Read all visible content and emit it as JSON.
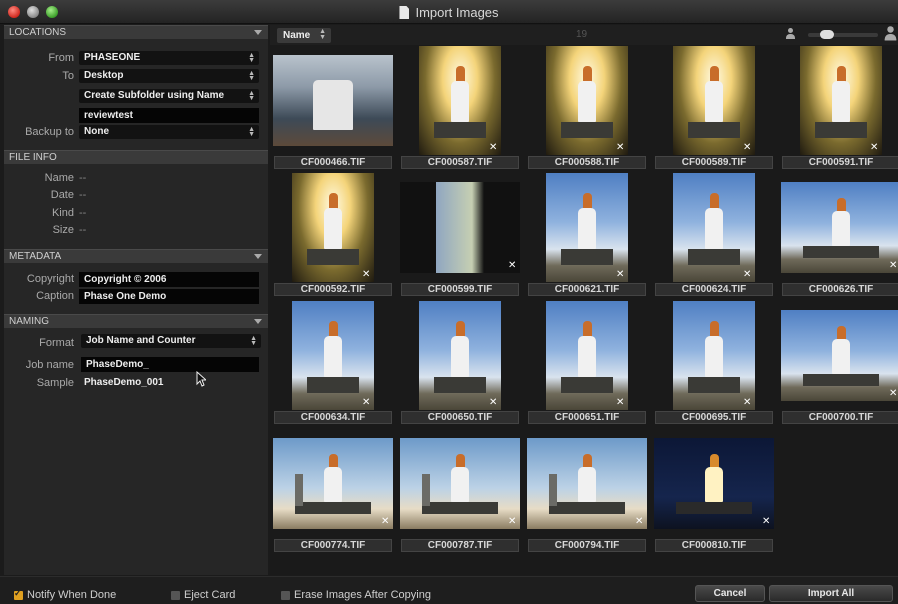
{
  "window": {
    "title": "Import Images"
  },
  "locations": {
    "header": "LOCATIONS",
    "from_label": "From",
    "from_value": "PHASEONE",
    "to_label": "To",
    "to_value": "Desktop",
    "subfolder_value": "Create Subfolder using Name",
    "subfolder_name": "reviewtest",
    "backup_label": "Backup to",
    "backup_value": "None"
  },
  "file_info": {
    "header": "FILE INFO",
    "rows": [
      {
        "label": "Name",
        "value": "--"
      },
      {
        "label": "Date",
        "value": "--"
      },
      {
        "label": "Kind",
        "value": "--"
      },
      {
        "label": "Size",
        "value": "--"
      }
    ]
  },
  "metadata": {
    "header": "METADATA",
    "copyright_label": "Copyright",
    "copyright_value": "Copyright © 2006",
    "caption_label": "Caption",
    "caption_value": "Phase One Demo"
  },
  "naming": {
    "header": "NAMING",
    "format_label": "Format",
    "format_value": "Job Name and Counter",
    "jobname_label": "Job name",
    "jobname_value": "PhaseDemo_",
    "sample_label": "Sample",
    "sample_value": "PhaseDemo_001"
  },
  "toolbar": {
    "sort_value": "Name",
    "count": "19"
  },
  "images": [
    {
      "name": "CF000466.TIF",
      "kind": "interior"
    },
    {
      "name": "CF000587.TIF",
      "kind": "night"
    },
    {
      "name": "CF000588.TIF",
      "kind": "night"
    },
    {
      "name": "CF000589.TIF",
      "kind": "night"
    },
    {
      "name": "CF000591.TIF",
      "kind": "night"
    },
    {
      "name": "CF000592.TIF",
      "kind": "night"
    },
    {
      "name": "CF000599.TIF",
      "kind": "door"
    },
    {
      "name": "CF000621.TIF",
      "kind": "sky"
    },
    {
      "name": "CF000624.TIF",
      "kind": "sky"
    },
    {
      "name": "CF000626.TIF",
      "kind": "sky"
    },
    {
      "name": "CF000634.TIF",
      "kind": "sky"
    },
    {
      "name": "CF000650.TIF",
      "kind": "sky"
    },
    {
      "name": "CF000651.TIF",
      "kind": "sky"
    },
    {
      "name": "CF000695.TIF",
      "kind": "sky"
    },
    {
      "name": "CF000700.TIF",
      "kind": "sky"
    },
    {
      "name": "CF000774.TIF",
      "kind": "dusk"
    },
    {
      "name": "CF000787.TIF",
      "kind": "dusk"
    },
    {
      "name": "CF000794.TIF",
      "kind": "dusk"
    },
    {
      "name": "CF000810.TIF",
      "kind": "nightpad"
    }
  ],
  "footer": {
    "notify_label": "Notify When Done",
    "notify_checked": true,
    "eject_label": "Eject Card",
    "eject_checked": false,
    "erase_label": "Erase Images After Copying",
    "erase_checked": false,
    "cancel_label": "Cancel",
    "import_label": "Import All"
  },
  "icons": {
    "close": "close-icon",
    "minimize": "minimize-icon",
    "zoom": "zoom-icon",
    "document": "document-icon",
    "remove": "remove-icon",
    "user": "user-icon",
    "pointer": "mouse-pointer-icon"
  }
}
